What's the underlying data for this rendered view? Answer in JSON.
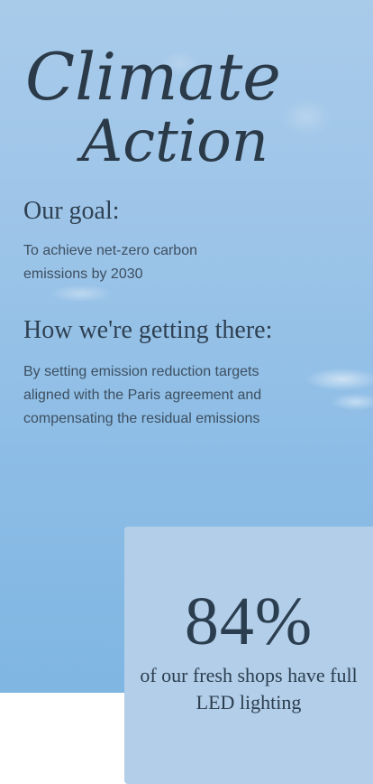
{
  "hero": {
    "title_line1": "Climate",
    "title_line2": "Action"
  },
  "goal": {
    "heading": "Our goal:",
    "text": "To achieve net-zero carbon emissions by 2030"
  },
  "approach": {
    "heading": "How we're getting there:",
    "text": "By setting emission reduction targets aligned with the Paris agreement and compensating the residual emissions"
  },
  "stat": {
    "value": "84%",
    "caption": "of our fresh shops have full LED lighting"
  },
  "colors": {
    "sky": "#9cc4e8",
    "card": "#b3cee8",
    "text_dark": "#2f4152"
  }
}
